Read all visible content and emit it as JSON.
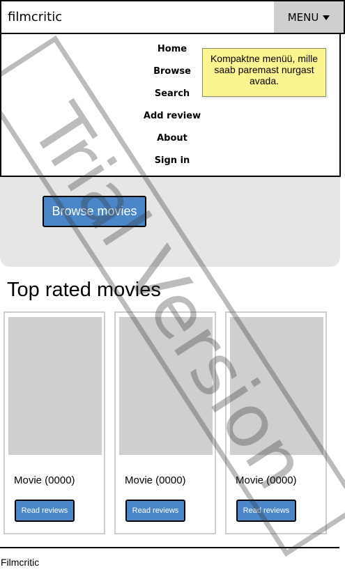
{
  "header": {
    "brand": "filmcritic",
    "menu_label": "MENU"
  },
  "menu": {
    "items": [
      {
        "label": "Home"
      },
      {
        "label": "Browse"
      },
      {
        "label": "Search"
      },
      {
        "label": "Add review"
      },
      {
        "label": "About"
      },
      {
        "label": "Sign in"
      }
    ],
    "note": "Kompaktne menüü, mille saab paremast nurgast avada."
  },
  "hero": {
    "button_label": "Browse movies"
  },
  "section": {
    "title": "Top rated movies"
  },
  "cards": [
    {
      "title": "Movie (0000)",
      "button_label": "Read reviews"
    },
    {
      "title": "Movie (0000)",
      "button_label": "Read reviews"
    },
    {
      "title": "Movie (0000)",
      "button_label": "Read reviews"
    }
  ],
  "footer": {
    "text": "Filmcritic"
  },
  "watermark": {
    "text": "Trial Version"
  },
  "colors": {
    "accent": "#4a86c8",
    "placeholder": "#cfcfcf",
    "note": "#fcf58f",
    "hero_bg": "#e6e6e6"
  }
}
